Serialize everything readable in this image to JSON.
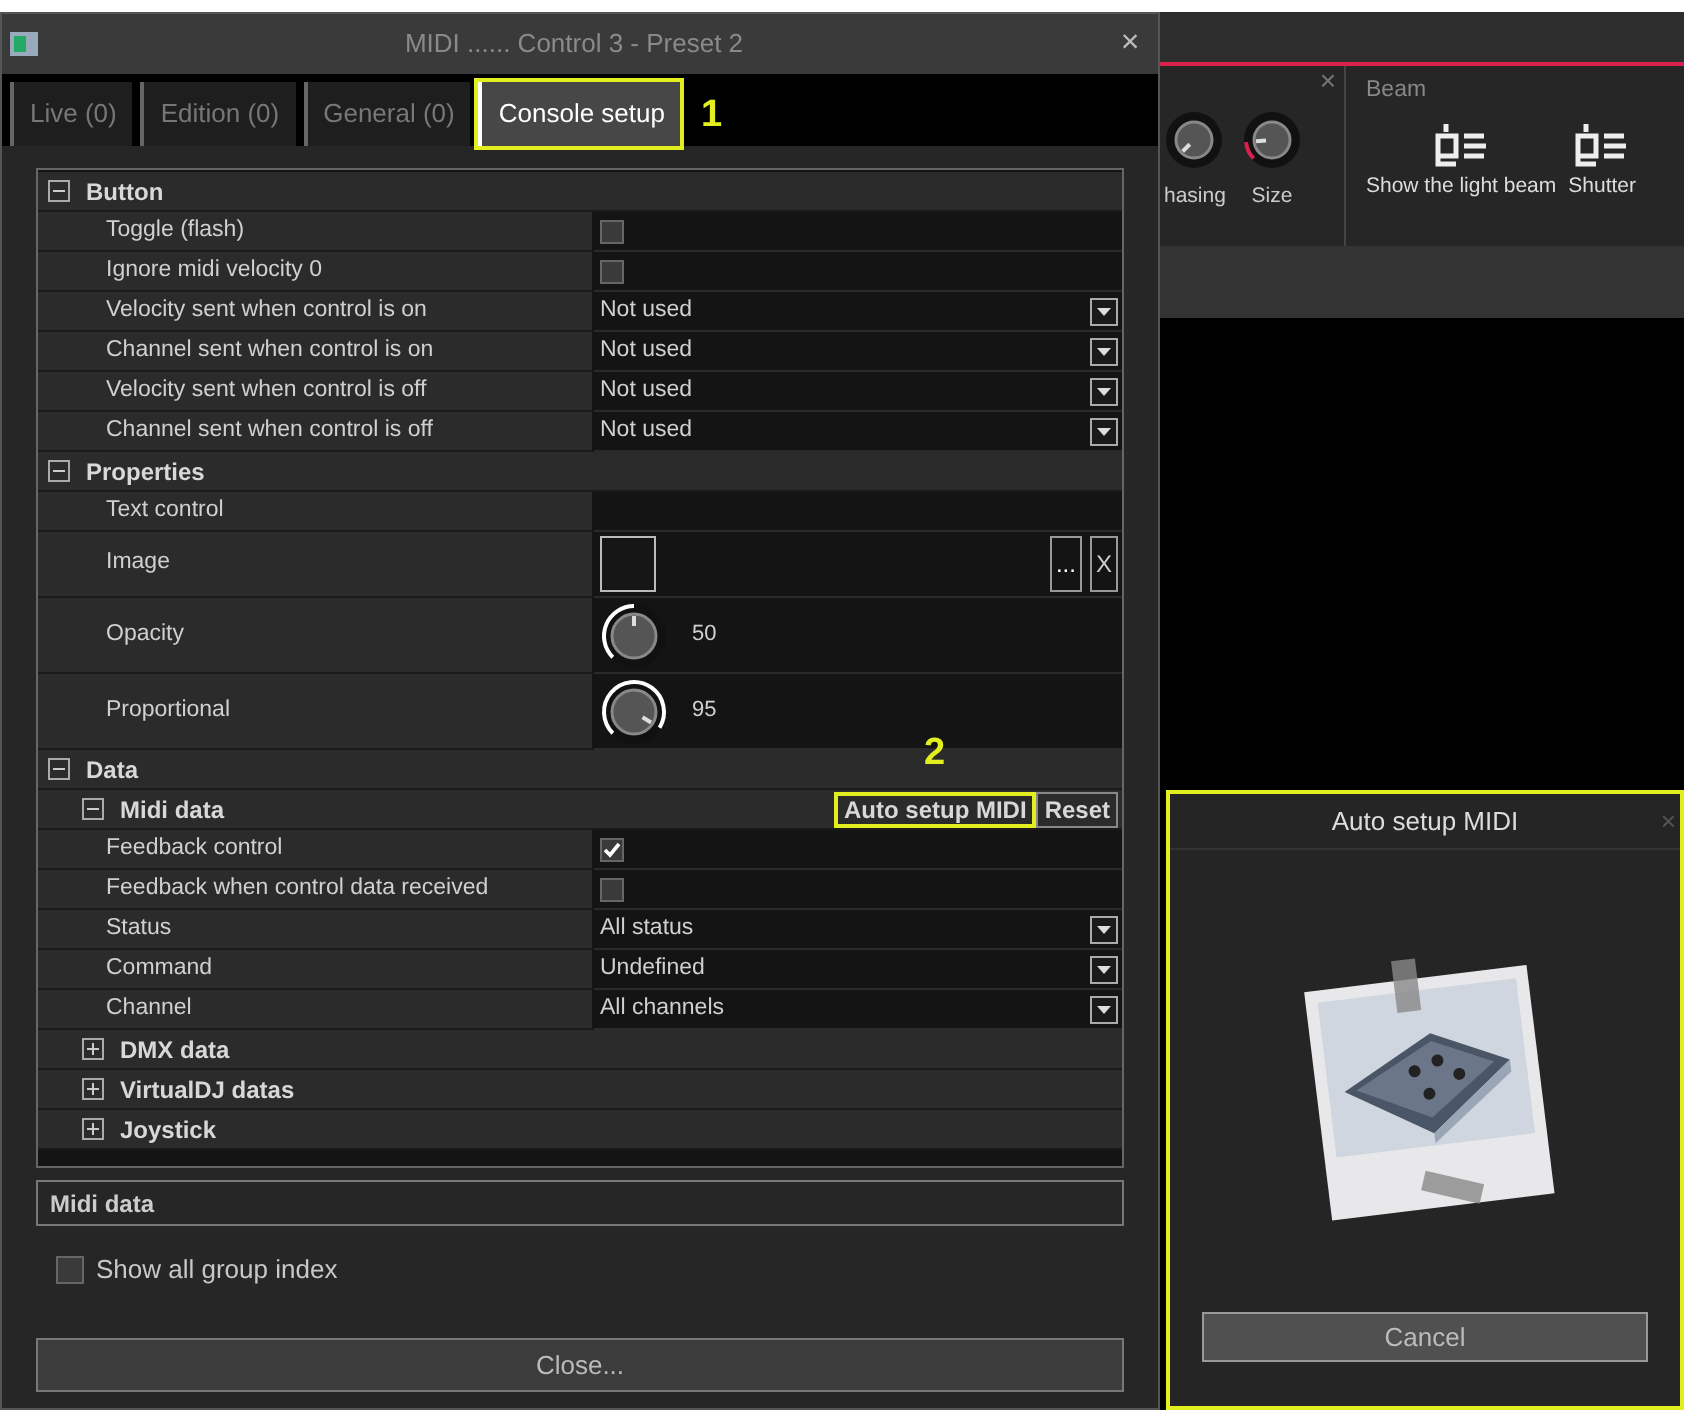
{
  "dialog": {
    "title": "MIDI ...... Control 3 - Preset 2",
    "close": "×",
    "tabs": [
      {
        "label": "Live (0)",
        "selected": false
      },
      {
        "label": "Edition (0)",
        "selected": false
      },
      {
        "label": "General (0)",
        "selected": false
      },
      {
        "label": "Console setup",
        "selected": true,
        "callout": "1"
      }
    ],
    "property_grid": [
      {
        "kind": "group",
        "label": "Button",
        "expanded": true,
        "children": [
          {
            "kind": "checkbox",
            "label": "Toggle (flash)",
            "checked": false
          },
          {
            "kind": "checkbox",
            "label": "Ignore midi velocity 0",
            "checked": false
          },
          {
            "kind": "dropdown",
            "label": "Velocity sent when control is on",
            "value": "Not used"
          },
          {
            "kind": "dropdown",
            "label": "Channel sent when control is on",
            "value": "Not used"
          },
          {
            "kind": "dropdown",
            "label": "Velocity sent when control is off",
            "value": "Not used"
          },
          {
            "kind": "dropdown",
            "label": "Channel sent when control is off",
            "value": "Not used"
          }
        ]
      },
      {
        "kind": "group",
        "label": "Properties",
        "expanded": true,
        "children": [
          {
            "kind": "text",
            "label": "Text control"
          },
          {
            "label": "Image",
            "browse": "...",
            "clear": "X"
          },
          {
            "kind": "knob",
            "label": "Opacity",
            "level": 0.5,
            "reading": "50"
          },
          {
            "kind": "knob",
            "label": "Proportional",
            "level": 0.95,
            "reading": "95"
          }
        ]
      },
      {
        "kind": "group",
        "label": "Data",
        "expanded": true,
        "children": [
          {
            "kind": "group",
            "label": "Midi data",
            "expanded": true,
            "actions": [
              {
                "label": "Auto setup MIDI",
                "callout": "2"
              },
              {
                "label": "Reset"
              }
            ],
            "children": [
              {
                "kind": "checkbox",
                "label": "Feedback control",
                "checked": true
              },
              {
                "kind": "checkbox",
                "label": "Feedback when control data received",
                "checked": false
              },
              {
                "kind": "dropdown",
                "label": "Status",
                "value": "All status"
              },
              {
                "kind": "dropdown",
                "label": "Command",
                "value": "Undefined"
              },
              {
                "kind": "dropdown",
                "label": "Channel",
                "value": "All channels"
              }
            ]
          },
          {
            "kind": "group",
            "label": "DMX data",
            "expanded": false
          },
          {
            "kind": "group",
            "label": "VirtualDJ datas",
            "expanded": false
          },
          {
            "kind": "group",
            "label": "Joystick",
            "expanded": false
          }
        ]
      }
    ],
    "description": "Midi data",
    "show_all_group_index": {
      "label": "Show all group index",
      "checked": false
    },
    "close_button": "Close..."
  },
  "background_app": {
    "knobs": [
      {
        "label": "hasing",
        "active": false
      },
      {
        "label": "Size",
        "active": true
      }
    ],
    "panel_close": "×",
    "section": "Beam",
    "buttons": [
      {
        "label": "Show the light beam"
      },
      {
        "label": "Shutter"
      }
    ]
  },
  "auto_setup_popup": {
    "title": "Auto setup MIDI",
    "close": "×",
    "button": "Cancel"
  }
}
